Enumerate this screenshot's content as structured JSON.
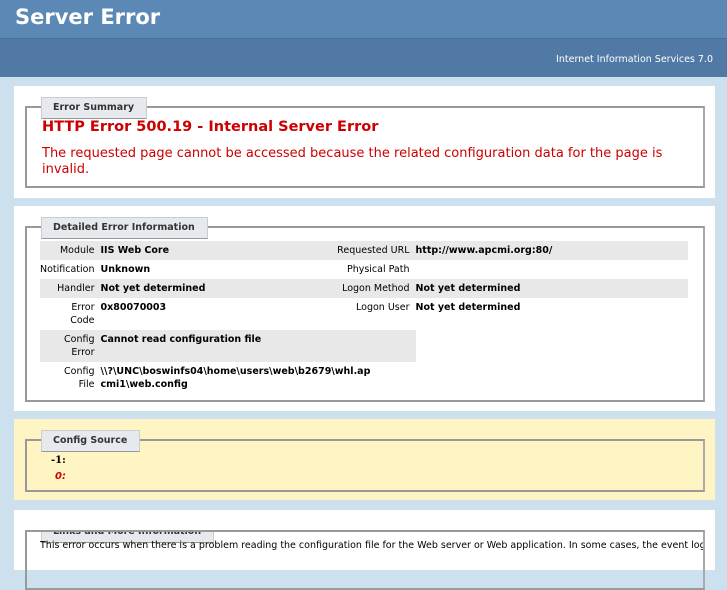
{
  "header": {
    "title": "Server Error",
    "product": "Internet Information Services 7.0"
  },
  "summary": {
    "legend": "Error Summary",
    "title": "HTTP Error 500.19 - Internal Server Error",
    "message": "The requested page cannot be accessed because the related configuration data for the page is invalid."
  },
  "details": {
    "legend": "Detailed Error Information",
    "rows": [
      {
        "k1": "Module",
        "v1": "IIS Web Core",
        "k2": "Requested URL",
        "v2": "http://www.apcmi.org:80/"
      },
      {
        "k1": "Notification",
        "v1": "Unknown",
        "k2": "Physical Path",
        "v2": ""
      },
      {
        "k1": "Handler",
        "v1": "Not yet determined",
        "k2": "Logon Method",
        "v2": "Not yet determined"
      },
      {
        "k1": "Error Code",
        "v1": "0x80070003",
        "k2": "Logon User",
        "v2": "Not yet determined"
      },
      {
        "k1": "Config Error",
        "v1": "Cannot read configuration file"
      },
      {
        "k1": "Config File",
        "v1": "\\\\?\\UNC\\boswinfs04\\home\\users\\web\\b2679\\whl.apcmi1\\web.config"
      }
    ]
  },
  "config_source": {
    "legend": "Config Source",
    "line1": "-1:",
    "line2": "0:"
  },
  "links": {
    "legend": "Links and More Information",
    "text": "This error occurs when there is a problem reading the configuration file for the Web server or Web application. In some cases, the event logs"
  }
}
